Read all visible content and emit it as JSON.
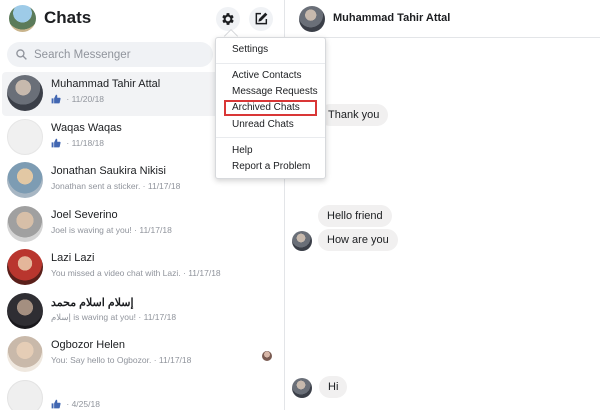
{
  "header": {
    "title": "Chats",
    "settings_icon": "gear-icon",
    "compose_icon": "compose-icon"
  },
  "search": {
    "placeholder": "Search Messenger"
  },
  "conversations": [
    {
      "name": "Muhammad Tahir Attal",
      "preview": "",
      "date": "11/20/18",
      "liked": true,
      "selected": true
    },
    {
      "name": "Waqas Waqas",
      "preview": "",
      "date": "11/18/18",
      "liked": true
    },
    {
      "name": "Jonathan Saukira Nikisi",
      "preview": "Jonathan sent a sticker.",
      "date": "11/17/18"
    },
    {
      "name": "Joel Severino",
      "preview": "Joel is waving at you!",
      "date": "11/17/18"
    },
    {
      "name": "Lazi Lazi",
      "preview": "You missed a video chat with Lazi.",
      "date": "11/17/18"
    },
    {
      "name": "إسلام اسلام محمد",
      "preview": "إسلام is waving at you!",
      "date": "11/17/18"
    },
    {
      "name": "Ogbozor Helen",
      "preview": "You: Say hello to Ogbozor.",
      "date": "11/17/18",
      "seen": true
    },
    {
      "name": "",
      "preview": "",
      "date": "4/25/18",
      "liked": true
    }
  ],
  "chat": {
    "peer_name": "Muhammad Tahir Attal",
    "messages": [
      "Thank you",
      "Hello friend",
      "How are you",
      "Hi"
    ]
  },
  "menu": {
    "items": [
      "Settings",
      "Active Contacts",
      "Message Requests",
      "Archived Chats",
      "Unread Chats",
      "Help",
      "Report a Problem"
    ],
    "highlighted": "Archived Chats",
    "highlight_color": "#d93636"
  },
  "colors": {
    "like_blue": "#4267b2",
    "bubble_gray": "#f1f0f0",
    "secondary_text": "#90949c"
  }
}
